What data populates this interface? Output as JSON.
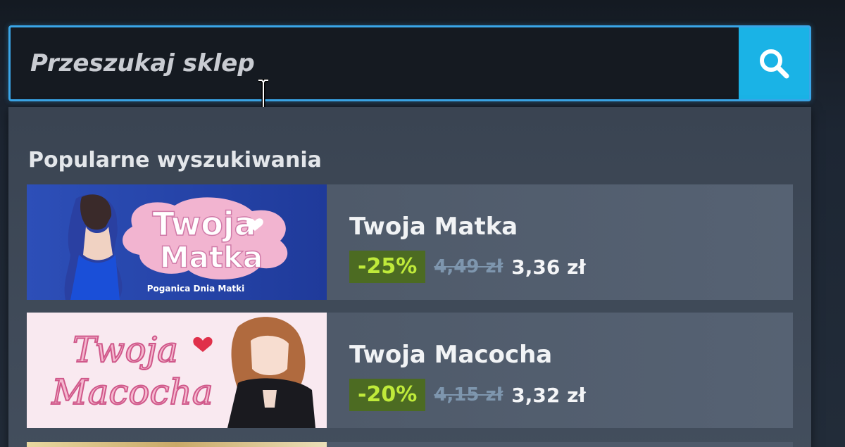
{
  "search": {
    "placeholder": "Przeszukaj sklep",
    "button_icon": "search-icon",
    "accent_color": "#1ab3e6"
  },
  "popular": {
    "title": "Popularne wyszukiwania",
    "items": [
      {
        "name": "Twoja Matka",
        "thumb_title_line1": "Twoja",
        "thumb_title_line2": "Matka",
        "thumb_subtitle": "Poganica Dnia Matki",
        "discount": "-25%",
        "original_price": "4,49 zł",
        "final_price": "3,36 zł"
      },
      {
        "name": "Twoja Macocha",
        "thumb_title_line1": "Twoja",
        "thumb_title_line2": "Macocha",
        "discount": "-20%",
        "original_price": "4,15 zł",
        "final_price": "3,32 zł"
      }
    ]
  },
  "colors": {
    "discount_bg": "#4c6b22",
    "discount_text": "#bfea3a",
    "dropdown_bg": "#3d4756",
    "item_bg": "#4e5a6a"
  }
}
